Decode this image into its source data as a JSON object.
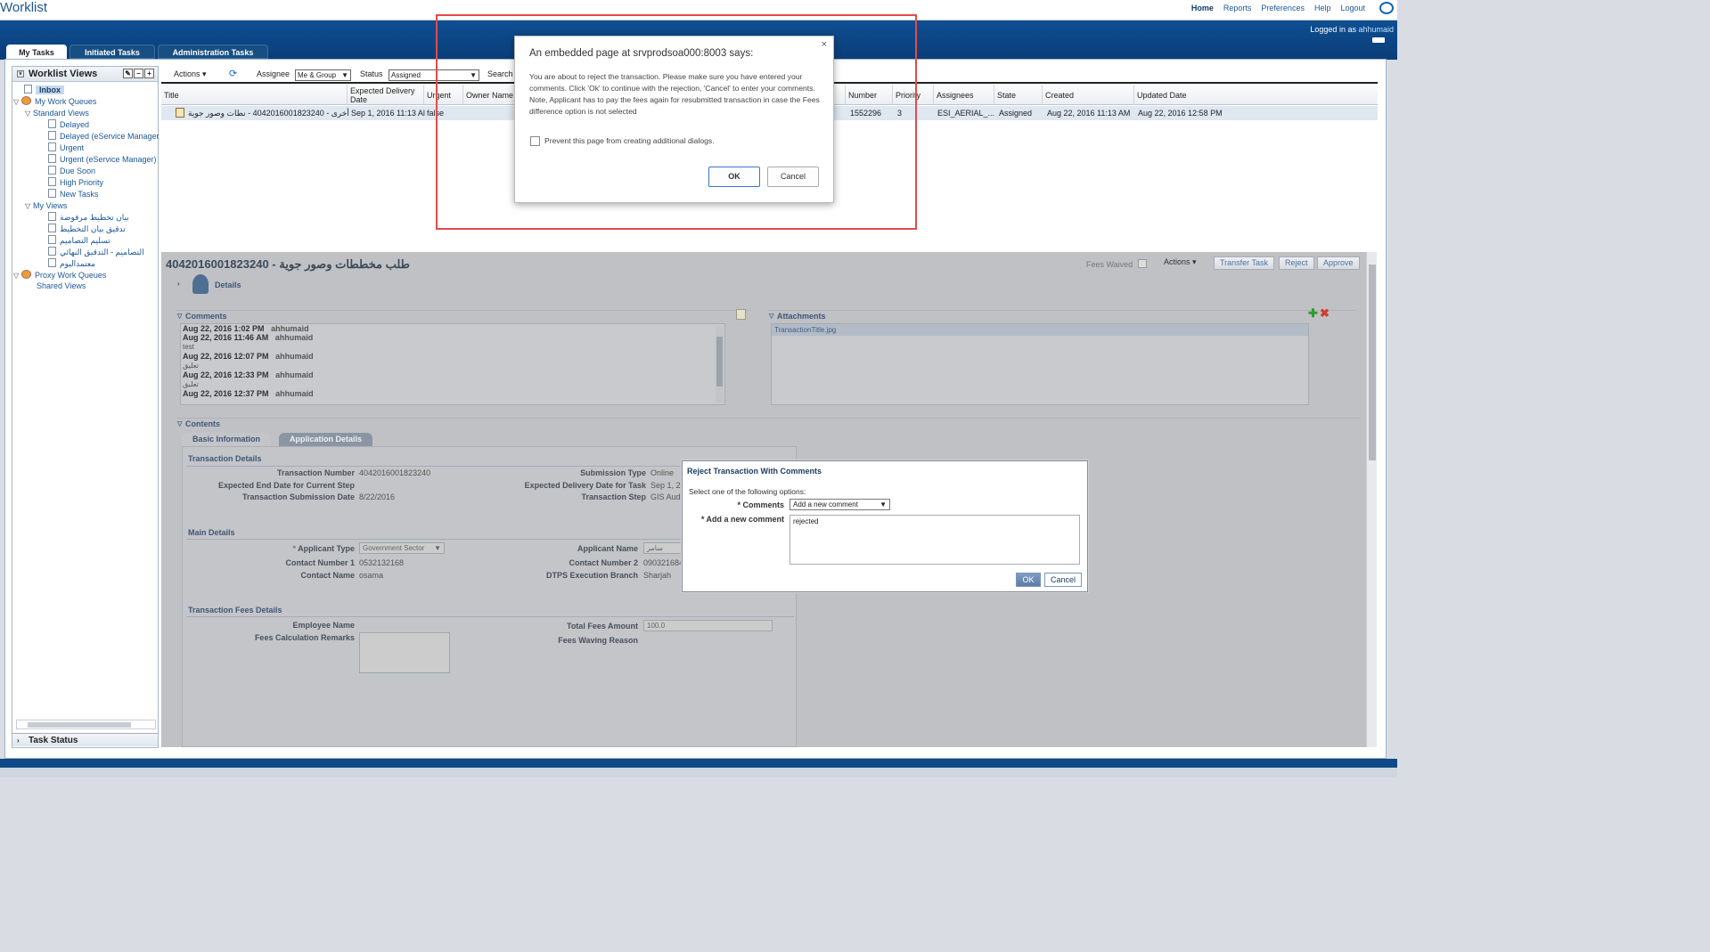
{
  "app_title": "Worklist",
  "top_links": [
    "Home",
    "Reports",
    "Preferences",
    "Help",
    "Logout"
  ],
  "logged_in": {
    "prefix": "Logged in as",
    "user": "ahhumaid"
  },
  "tabs": [
    "My Tasks",
    "Initiated Tasks",
    "Administration Tasks"
  ],
  "sidebar": {
    "title": "Worklist Views",
    "tools": [
      "✎",
      "−",
      "+"
    ],
    "inbox": "Inbox",
    "my_work_queues": "My Work Queues",
    "standard_views": "Standard Views",
    "standard_items": [
      "Delayed",
      "Delayed (eService Manager",
      "Urgent",
      "Urgent (eService Manager)",
      "Due Soon",
      "High Priority",
      "New Tasks"
    ],
    "my_views": "My Views",
    "my_view_items": [
      "بيان تخطيط مرفوضة",
      "تدقيق بيان التخطيط",
      "تسليم التصاميم",
      "التصاميم - التدقيق النهائي",
      "معتمداليوم"
    ],
    "proxy_queues": "Proxy Work Queues",
    "shared_views": "Shared Views",
    "task_status": "Task Status"
  },
  "toolbar": {
    "actions": "Actions ▾",
    "assignee_label": "Assignee",
    "assignee_value": "Me & Group",
    "status_label": "Status",
    "status_value": "Assigned",
    "search_label": "Search"
  },
  "columns": [
    "Title",
    "Expected Delivery Date",
    "Urgent",
    "Owner Name",
    "Number",
    "Priority",
    "Assignees",
    "State",
    "Created",
    "Updated Date"
  ],
  "task_row": {
    "title": "أخرى - 4042016001823240 - نطات وصور جوية",
    "expected": "Sep 1, 2016 11:13 Al",
    "urgent": "false",
    "number": "1552296",
    "priority": "3",
    "assignees": "ESI_AERIAL_...",
    "state": "Assigned",
    "created": "Aug 22, 2016 11:13 AM",
    "updated": "Aug 22, 2016 12:58 PM"
  },
  "detail": {
    "title": "4042016001823240 - طلب مخططات وصور جوية",
    "fees_waived": "Fees Waived",
    "actions": "Actions ▾",
    "transfer": "Transfer Task",
    "reject": "Reject",
    "approve": "Approve",
    "details_label": "Details",
    "comments_label": "Comments",
    "attachments_label": "Attachments",
    "comments": [
      {
        "date": "Aug 22, 2016 1:02 PM",
        "user": "ahhumaid",
        "text": ""
      },
      {
        "date": "Aug 22, 2016 11:46 AM",
        "user": "ahhumaid",
        "text": "test"
      },
      {
        "date": "Aug 22, 2016 12:07 PM",
        "user": "ahhumaid",
        "text": "تعليق"
      },
      {
        "date": "Aug 22, 2016 12:33 PM",
        "user": "ahhumaid",
        "text": "تعليق"
      },
      {
        "date": "Aug 22, 2016 12:37 PM",
        "user": "ahhumaid",
        "text": ""
      }
    ],
    "attachment": "TransactionTitle.jpg",
    "contents_label": "Contents",
    "content_tabs": [
      "Basic Information",
      "Application Details"
    ],
    "transaction_details": "Transaction Details",
    "transaction_number_label": "Transaction Number",
    "transaction_number": "4042016001823240",
    "expected_end_label": "Expected End Date for Current Step",
    "submission_date_label": "Transaction Submission Date",
    "submission_date": "8/22/2016",
    "submission_type_label": "Submission Type",
    "submission_type": "Online",
    "expected_delivery_label": "Expected Delivery Date for Task",
    "expected_delivery": "Sep 1, 20",
    "transaction_step_label": "Transaction Step",
    "transaction_step": "GIS Audi",
    "main_details": "Main Details",
    "applicant_type_label": "Applicant Type",
    "applicant_type": "Government Sector",
    "contact1_label": "Contact Number 1",
    "contact1": "0532132168",
    "contact_name_label": "Contact Name",
    "contact_name": "osama",
    "applicant_name_label": "Applicant Name",
    "applicant_name": "سامر",
    "contact2_label": "Contact Number 2",
    "contact2": "090321684",
    "branch_label": "DTPS Execution Branch",
    "branch": "Sharjah",
    "fees_details": "Transaction Fees Details",
    "employee_label": "Employee Name",
    "remarks_label": "Fees Calculation Remarks",
    "total_fees_label": "Total Fees Amount",
    "total_fees": "100.0",
    "waving_reason_label": "Fees Waving Reason"
  },
  "browser_dialog": {
    "title": "An embedded page at srvprodsoa000:8003 says:",
    "close": "×",
    "message": "You are about to reject the transaction. Please make sure you have entered your comments. Click 'Ok' to continue with the rejection, 'Cancel' to enter your comments.",
    "note": "Note, Applicant has to pay the fees again for resubmitted transaction in case the Fees difference option is not selected",
    "checkbox": "Prevent this page from creating additional dialogs.",
    "ok": "OK",
    "cancel": "Cancel"
  },
  "reject_dialog": {
    "title": "Reject Transaction With Comments",
    "subtitle": "Select one of the following options:",
    "comments_label": "* Comments",
    "comments_value": "Add a new comment",
    "new_comment_label": "* Add a new comment",
    "new_comment_value": "rejected",
    "ok": "OK",
    "cancel": "Cancel"
  },
  "colors": {
    "banner": "#0e4f93",
    "link": "#1b5798",
    "highlight": "#e24b4b"
  }
}
